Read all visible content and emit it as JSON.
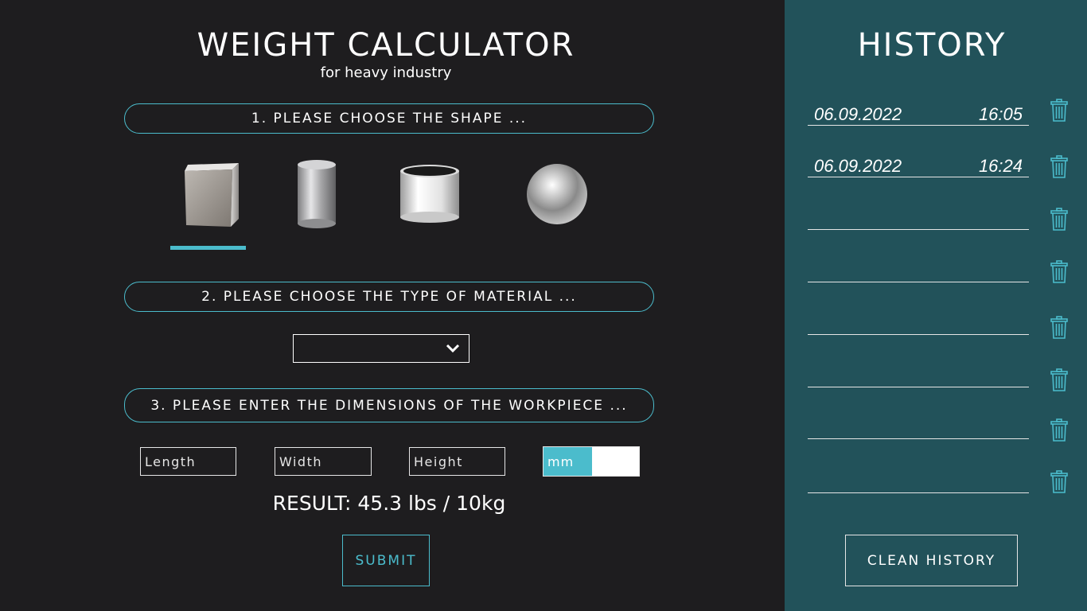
{
  "app": {
    "title": "WEIGHT CALCULATOR",
    "subtitle": "for heavy industry"
  },
  "steps": {
    "shape": "1. PLEASE CHOOSE THE SHAPE ...",
    "material": "2. PLEASE CHOOSE THE TYPE OF MATERIAL ...",
    "dimensions": "3. PLEASE ENTER THE DIMENSIONS OF THE WORKPIECE ..."
  },
  "shapes": {
    "items": [
      "cube-icon",
      "cylinder-icon",
      "tube-icon",
      "sphere-icon"
    ],
    "selected_index": 0
  },
  "material": {
    "selected": ""
  },
  "dimensions": {
    "length_placeholder": "Length",
    "width_placeholder": "Width",
    "height_placeholder": "Height"
  },
  "unit_toggle": {
    "active": "mm"
  },
  "result": {
    "text": "RESULT: 45.3 lbs / 10kg"
  },
  "actions": {
    "submit": "SUBMIT",
    "clean_history": "CLEAN HISTORY"
  },
  "history": {
    "title": "HISTORY",
    "entries": [
      {
        "date": "06.09.2022",
        "time": "16:05"
      },
      {
        "date": "06.09.2022",
        "time": "16:24"
      },
      {
        "date": "",
        "time": ""
      },
      {
        "date": "",
        "time": ""
      },
      {
        "date": "",
        "time": ""
      },
      {
        "date": "",
        "time": ""
      },
      {
        "date": "",
        "time": ""
      },
      {
        "date": "",
        "time": ""
      }
    ]
  },
  "colors": {
    "accent": "#4bbccc",
    "background": "#1e1d1f",
    "sidebar": "#22525a"
  }
}
